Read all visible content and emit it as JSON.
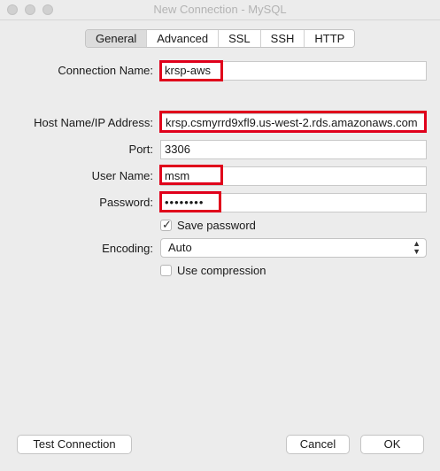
{
  "window": {
    "title": "New Connection - MySQL"
  },
  "tabs": [
    {
      "label": "General",
      "active": true
    },
    {
      "label": "Advanced",
      "active": false
    },
    {
      "label": "SSL",
      "active": false
    },
    {
      "label": "SSH",
      "active": false
    },
    {
      "label": "HTTP",
      "active": false
    }
  ],
  "form": {
    "connection_name": {
      "label": "Connection Name:",
      "value": "krsp-aws"
    },
    "host": {
      "label": "Host Name/IP Address:",
      "value": "krsp.csmyrrd9xfl9.us-west-2.rds.amazonaws.com"
    },
    "port": {
      "label": "Port:",
      "value": "3306"
    },
    "user": {
      "label": "User Name:",
      "value": "msm"
    },
    "password": {
      "label": "Password:",
      "value": "••••••••"
    },
    "save_password": {
      "label": "Save password",
      "checked": true
    },
    "encoding": {
      "label": "Encoding:",
      "value": "Auto"
    },
    "use_compression": {
      "label": "Use compression",
      "checked": false
    }
  },
  "buttons": {
    "test_connection": "Test Connection",
    "cancel": "Cancel",
    "ok": "OK"
  },
  "colors": {
    "highlight": "#e0001b",
    "background": "#ececec"
  }
}
